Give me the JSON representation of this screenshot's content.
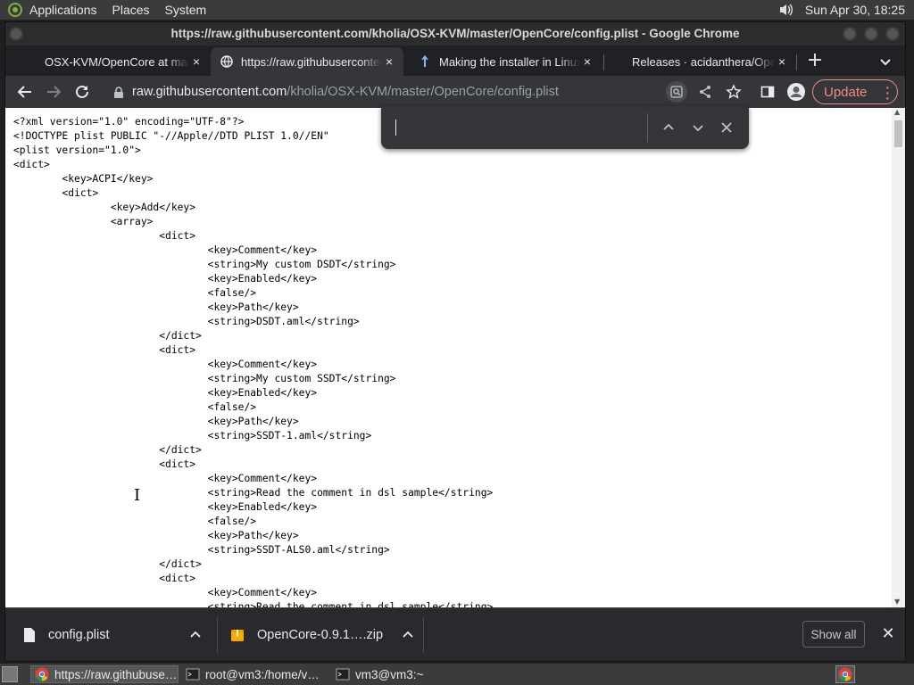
{
  "top_panel": {
    "menus": [
      "Applications",
      "Places",
      "System"
    ],
    "clock": "Sun Apr 30, 18:25"
  },
  "window": {
    "title": "https://raw.githubusercontent.com/kholia/OSX-KVM/master/OpenCore/config.plist - Google Chrome"
  },
  "tabs": [
    {
      "label": "OSX-KVM/OpenCore at master",
      "close": "×"
    },
    {
      "label": "https://raw.githubusercontent.com",
      "close": "×"
    },
    {
      "label": "Making the installer in Linux",
      "close": "×"
    },
    {
      "label": "Releases · acidanthera/OpenCorePkg",
      "close": "×"
    }
  ],
  "toolbar": {
    "url_host": "raw.githubusercontent.com",
    "url_path": "/kholia/OSX-KVM/master/OpenCore/config.plist",
    "update_label": "Update"
  },
  "find_bar": {
    "value": ""
  },
  "content": {
    "lines": [
      "<?xml version=\"1.0\" encoding=\"UTF-8\"?>",
      "<!DOCTYPE plist PUBLIC \"-//Apple//DTD PLIST 1.0//EN\"",
      "<plist version=\"1.0\">",
      "<dict>",
      "\t<key>ACPI</key>",
      "\t<dict>",
      "\t\t<key>Add</key>",
      "\t\t<array>",
      "\t\t\t<dict>",
      "\t\t\t\t<key>Comment</key>",
      "\t\t\t\t<string>My custom DSDT</string>",
      "\t\t\t\t<key>Enabled</key>",
      "\t\t\t\t<false/>",
      "\t\t\t\t<key>Path</key>",
      "\t\t\t\t<string>DSDT.aml</string>",
      "\t\t\t</dict>",
      "\t\t\t<dict>",
      "\t\t\t\t<key>Comment</key>",
      "\t\t\t\t<string>My custom SSDT</string>",
      "\t\t\t\t<key>Enabled</key>",
      "\t\t\t\t<false/>",
      "\t\t\t\t<key>Path</key>",
      "\t\t\t\t<string>SSDT-1.aml</string>",
      "\t\t\t</dict>",
      "\t\t\t<dict>",
      "\t\t\t\t<key>Comment</key>",
      "\t\t\t\t<string>Read the comment in dsl sample</string>",
      "\t\t\t\t<key>Enabled</key>",
      "\t\t\t\t<false/>",
      "\t\t\t\t<key>Path</key>",
      "\t\t\t\t<string>SSDT-ALS0.aml</string>",
      "\t\t\t</dict>",
      "\t\t\t<dict>",
      "\t\t\t\t<key>Comment</key>",
      "\t\t\t\t<string>Read the comment in dsl sample</string>"
    ]
  },
  "downloads": {
    "items": [
      {
        "name": "config.plist"
      },
      {
        "name": "OpenCore-0.9.1….zip"
      }
    ],
    "show_all": "Show all"
  },
  "taskbar": {
    "tasks": [
      {
        "label": "https://raw.githubuse…"
      },
      {
        "label": "root@vm3:/home/v…"
      },
      {
        "label": "vm3@vm3:~"
      }
    ]
  }
}
